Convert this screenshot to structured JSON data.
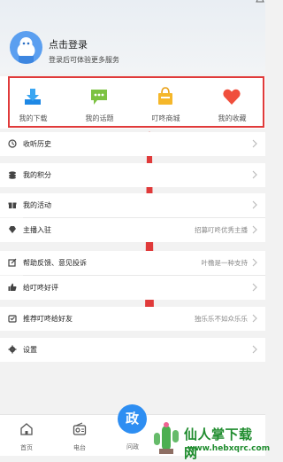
{
  "profile": {
    "login_title": "点击登录",
    "login_subtitle": "登录后可体验更多服务"
  },
  "quick_actions": [
    {
      "label": "我的下载",
      "icon": "download-icon"
    },
    {
      "label": "我的话题",
      "icon": "chat-bubble-icon"
    },
    {
      "label": "叮咚商城",
      "icon": "shopping-bag-icon"
    },
    {
      "label": "我的收藏",
      "icon": "heart-icon"
    }
  ],
  "menu": [
    {
      "label": "收听历史",
      "value": "",
      "icon": "clock-icon"
    },
    {
      "label": "我的积分",
      "value": "",
      "icon": "points-icon"
    },
    {
      "label": "我的活动",
      "value": "",
      "icon": "gift-icon"
    },
    {
      "label": "主播入驻",
      "value": "招募叮咚优秀主播",
      "icon": "diamond-icon"
    },
    {
      "label": "帮助反馈、意见投诉",
      "value": "叶檐是一种支持",
      "icon": "feedback-icon"
    },
    {
      "label": "给叮咚好评",
      "value": "",
      "icon": "thumb-up-icon"
    },
    {
      "label": "推荐叮咚给好友",
      "value": "独乐乐不如众乐乐",
      "icon": "share-icon"
    },
    {
      "label": "设置",
      "value": "",
      "icon": "gear-icon"
    }
  ],
  "tabs": [
    {
      "label": "首页",
      "icon": "home-icon"
    },
    {
      "label": "电台",
      "icon": "radio-icon"
    },
    {
      "label": "问政",
      "icon": "center-action-icon"
    }
  ],
  "center_button_glyph": "政",
  "watermark": {
    "text": "仙人掌下载网",
    "url": "www.hebxqrc.com"
  },
  "colors": {
    "accent": "#2e8ef2",
    "highlight_box": "#e03a3a",
    "watermark": "#1f8c2e"
  }
}
